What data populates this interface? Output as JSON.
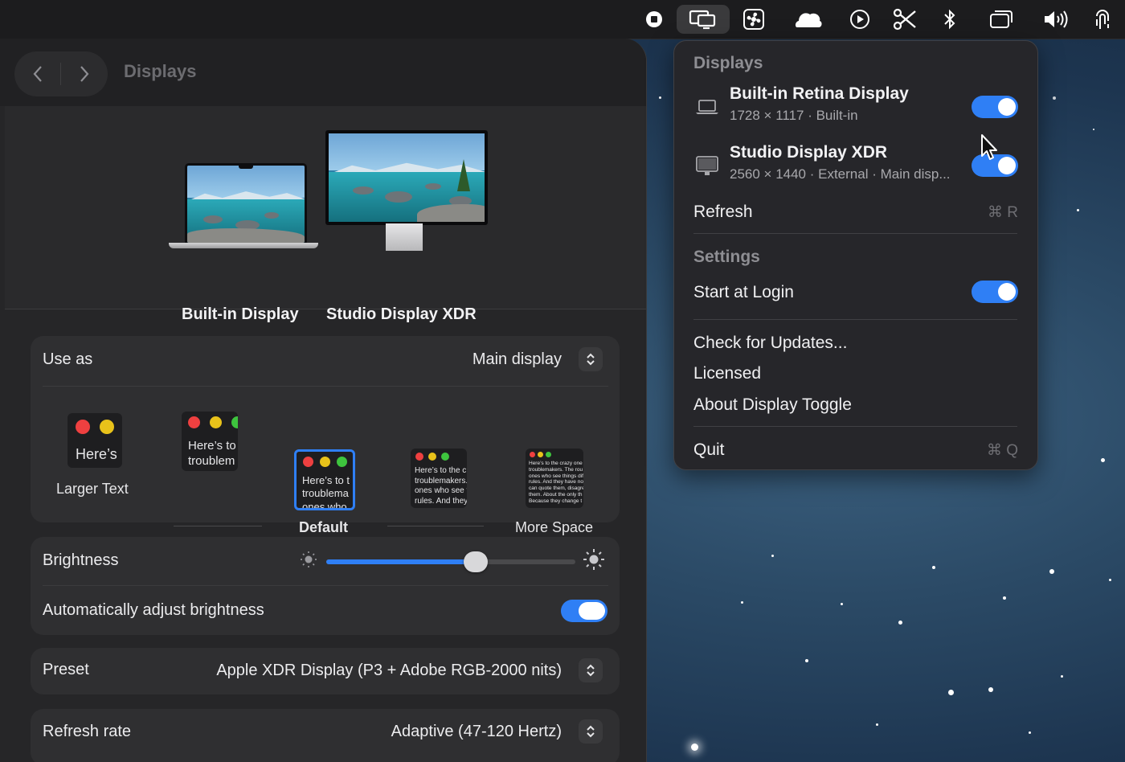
{
  "menubar": {
    "icons": [
      "record-stop-icon",
      "display-toggle-icon",
      "fan-icon",
      "cloud-icon",
      "play-icon",
      "scissors-icon",
      "bluetooth-icon",
      "window-stack-icon",
      "volume-icon",
      "fingerprint-icon"
    ]
  },
  "window": {
    "title": "Displays",
    "displays": [
      {
        "label": "Built-in Display"
      },
      {
        "label": "Studio Display XDR"
      }
    ],
    "use_as": {
      "label": "Use as",
      "value": "Main display"
    },
    "resolution": {
      "options": [
        {
          "label": "Larger Text",
          "preview": "Here’s"
        },
        {
          "label": "",
          "preview": "Here’s to\ntroublem"
        },
        {
          "label": "Default",
          "preview": "Here’s to t\ntroublema\nones who"
        },
        {
          "label": "",
          "preview": "Here’s to the c\ntroublemakers.\nones who see t\nrules. And they"
        },
        {
          "label": "More Space",
          "preview": "Here’s to the crazy one\ntroublemakers. The rou\nones who see things dif\nrules. And they have no\ncan quote them, disagre\nthem. About the only th\nBecause they change t"
        }
      ],
      "selected_index": 2
    },
    "brightness": {
      "label": "Brightness",
      "level": 0.6
    },
    "auto_brightness": {
      "label": "Automatically adjust brightness",
      "on": true
    },
    "preset": {
      "label": "Preset",
      "value": "Apple XDR Display (P3 + Adobe RGB-2000 nits)"
    },
    "refresh_rate": {
      "label": "Refresh rate",
      "value": "Adaptive (47-120 Hertz)"
    }
  },
  "menu": {
    "displays_header": "Displays",
    "displays": [
      {
        "name": "Built-in Retina Display",
        "detail": "1728 × 1117 · Built-in",
        "enabled": true,
        "icon": "laptop-icon"
      },
      {
        "name": "Studio Display XDR",
        "detail": "2560 × 1440 · External · Main disp...",
        "enabled": true,
        "icon": "monitor-icon"
      }
    ],
    "refresh": {
      "label": "Refresh",
      "shortcut": "⌘ R"
    },
    "settings_header": "Settings",
    "start_at_login": {
      "label": "Start at Login",
      "on": true
    },
    "check_updates": "Check for Updates...",
    "licensed": "Licensed",
    "about": "About Display Toggle",
    "quit": {
      "label": "Quit",
      "shortcut": "⌘ Q"
    }
  },
  "colors": {
    "accent": "#2f7ff5",
    "window_bg": "#262628",
    "menu_bg": "#26262a"
  }
}
